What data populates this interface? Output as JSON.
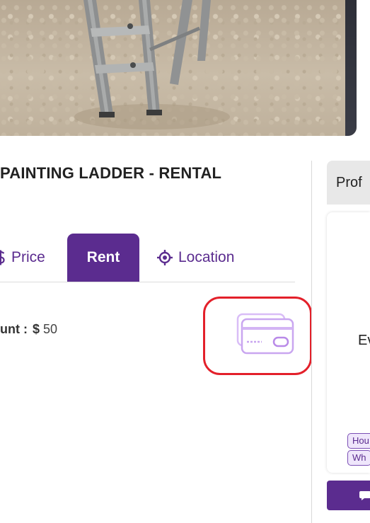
{
  "listing": {
    "title": "PAINTING LADDER - RENTAL"
  },
  "tabs": [
    {
      "label": "Price",
      "icon": "dollar-icon"
    },
    {
      "label": "Rent",
      "icon": ""
    },
    {
      "label": "Location",
      "icon": "crosshair-icon"
    }
  ],
  "active_tab": "Rent",
  "rent": {
    "amount_label": "unt :",
    "currency": "$",
    "amount": "50",
    "payment_icon": "credit-cards-icon"
  },
  "side": {
    "header": "Prof",
    "name": "Ev",
    "chips": [
      "Hou",
      "Wh"
    ],
    "button_icon": "chat-icon"
  },
  "colors": {
    "accent": "#5b2c8f",
    "highlight": "#e3202a",
    "icon_tint": "#c9a6f0"
  }
}
